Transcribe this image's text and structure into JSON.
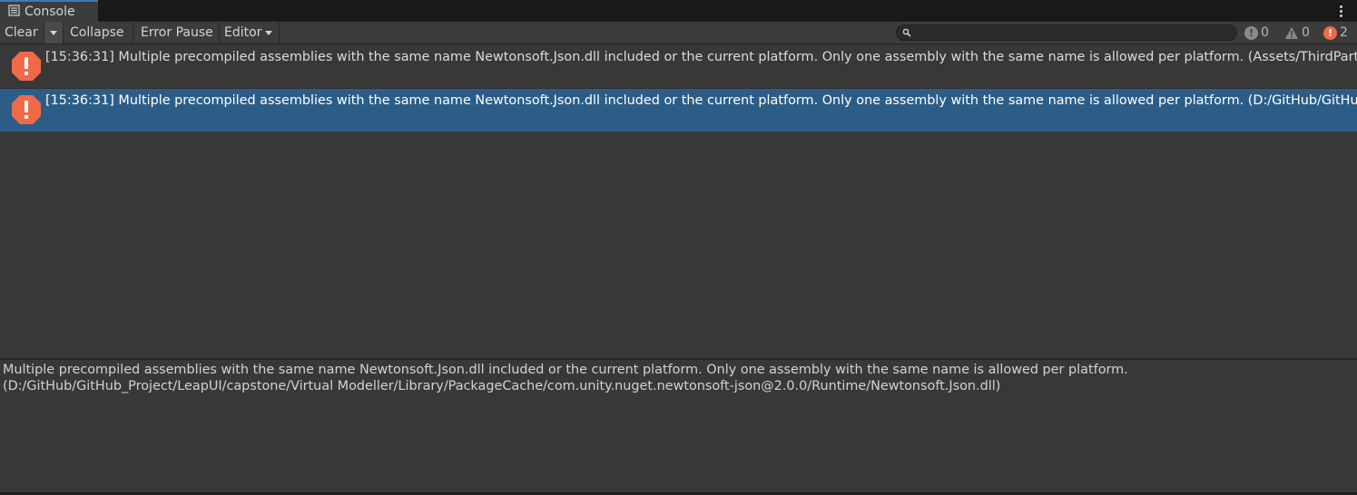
{
  "tab": {
    "icon": "console-list-icon",
    "label": "Console"
  },
  "toolbar": {
    "clear": "Clear",
    "collapse": "Collapse",
    "error_pause": "Error Pause",
    "editor": "Editor",
    "search_placeholder": ""
  },
  "counters": {
    "log": "0",
    "warning": "0",
    "error": "2"
  },
  "colors": {
    "accent": "#3a79bb",
    "selected_row": "#2c5d87",
    "error_icon": "#f06a4a"
  },
  "entries": [
    {
      "text": "[15:36:31] Multiple precompiled assemblies with the same name Newtonsoft.Json.dll included or the current platform. Only one assembly with the same name is allowed per platform. (Assets/ThirdParty/"
    },
    {
      "text": "[15:36:31] Multiple precompiled assemblies with the same name Newtonsoft.Json.dll included or the current platform. Only one assembly with the same name is allowed per platform. (D:/GitHub/GitHub_P"
    }
  ],
  "detail": {
    "line1": "Multiple precompiled assemblies with the same name Newtonsoft.Json.dll included or the current platform. Only one assembly with the same name is allowed per platform.",
    "line2": "(D:/GitHub/GitHub_Project/LeapUI/capstone/Virtual Modeller/Library/PackageCache/com.unity.nuget.newtonsoft-json@2.0.0/Runtime/Newtonsoft.Json.dll)"
  }
}
